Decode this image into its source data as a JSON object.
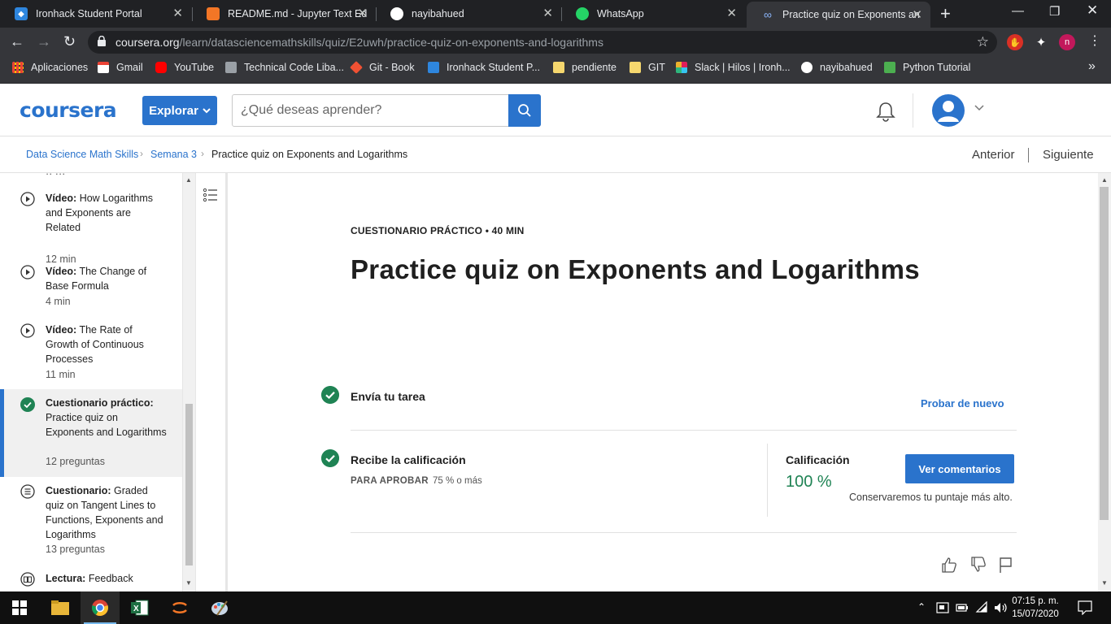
{
  "browser": {
    "tabs": [
      {
        "title": "Ironhack Student Portal",
        "icon": "ironhack-icon",
        "color": "#2e86de"
      },
      {
        "title": "README.md - Jupyter Text Edi",
        "icon": "jupyter-icon",
        "color": "#f37626"
      },
      {
        "title": "nayibahued",
        "icon": "github-icon",
        "color": "#ffffff"
      },
      {
        "title": "WhatsApp",
        "icon": "whatsapp-icon",
        "color": "#25d366"
      },
      {
        "title": "Practice quiz on Exponents and",
        "icon": "coursera-icon",
        "color": "#8ab4f8"
      }
    ],
    "active_tab_index": 4,
    "url_domain": "coursera.org",
    "url_path": "/learn/datasciencemathskills/quiz/E2uwh/practice-quiz-on-exponents-and-logarithms",
    "profile_initial": "n",
    "bookmarks": [
      {
        "label": "Aplicaciones",
        "icon": "apps-grid-icon",
        "color": "#ea4335"
      },
      {
        "label": "Gmail",
        "icon": "gmail-icon",
        "color": "#ea4335"
      },
      {
        "label": "YouTube",
        "icon": "youtube-icon",
        "color": "#ff0000"
      },
      {
        "label": "Technical Code Liba...",
        "icon": "bookmark-icon",
        "color": "#9aa0a6"
      },
      {
        "label": "Git - Book",
        "icon": "git-icon",
        "color": "#f05133"
      },
      {
        "label": "Ironhack Student P...",
        "icon": "ironhack-icon",
        "color": "#2e86de"
      },
      {
        "label": "pendiente",
        "icon": "folder-icon",
        "color": "#f5d76e"
      },
      {
        "label": "GIT",
        "icon": "folder-icon",
        "color": "#f5d76e"
      },
      {
        "label": "Slack | Hilos | Ironh...",
        "icon": "slack-icon",
        "color": "#e01e5a"
      },
      {
        "label": "nayibahued",
        "icon": "github-icon",
        "color": "#ffffff"
      },
      {
        "label": "Python Tutorial",
        "icon": "w3-icon",
        "color": "#4caf50"
      }
    ],
    "bookmarks_overflow": "»"
  },
  "header": {
    "logo": "coursera",
    "explore_label": "Explorar",
    "search_placeholder": "¿Qué deseas aprender?"
  },
  "breadcrumb": {
    "items": [
      "Data Science Math Skills",
      "Semana 3",
      "Practice quiz on Exponents and Logarithms"
    ],
    "prev_label": "Anterior",
    "next_label": "Siguiente"
  },
  "sidebar": {
    "items": [
      {
        "kind": "Vídeo:",
        "title": "How Logarithms and Exponents are Related",
        "meta": "12 min",
        "icon": "play-icon",
        "active": false
      },
      {
        "kind": "Vídeo:",
        "title": "The Change of Base Formula",
        "meta": "4 min",
        "icon": "play-icon",
        "active": false
      },
      {
        "kind": "Vídeo:",
        "title": "The Rate of Growth of Continuous Processes",
        "meta": "11 min",
        "icon": "play-icon",
        "active": false
      },
      {
        "kind": "Cuestionario práctico:",
        "title": "Practice quiz on Exponents and Logarithms",
        "meta": "12 preguntas",
        "icon": "check-circle-icon",
        "active": true
      },
      {
        "kind": "Cuestionario:",
        "title": "Graded quiz on Tangent Lines to Functions, Exponents and Logarithms",
        "meta": "13 preguntas",
        "icon": "quiz-icon",
        "active": false
      },
      {
        "kind": "Lectura:",
        "title": "Feedback",
        "meta": "",
        "icon": "book-icon",
        "active": false
      }
    ]
  },
  "quiz": {
    "eyebrow": "CUESTIONARIO PRÁCTICO • 40 MIN",
    "title": "Practice quiz on Exponents and Logarithms",
    "step1_title": "Envía tu tarea",
    "retry_label": "Probar de nuevo",
    "step2_title": "Recibe la calificación",
    "pass_label": "PARA APROBAR",
    "pass_value": "75 % o más",
    "grade_label": "Calificación",
    "grade_value": "100 %",
    "feedback_button": "Ver comentarios",
    "keep_note": "Conservaremos tu puntaje más alto."
  },
  "taskbar": {
    "time": "07:15 p. m.",
    "date": "15/07/2020"
  },
  "colors": {
    "accent": "#2a73cc",
    "success": "#1f8354"
  }
}
